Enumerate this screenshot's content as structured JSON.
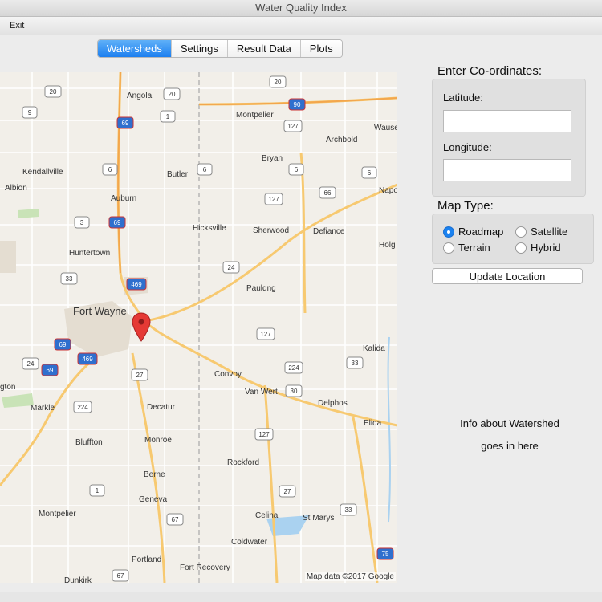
{
  "window": {
    "title": "Water Quality Index"
  },
  "menu": {
    "exit": "Exit"
  },
  "tabs": [
    "Watersheds",
    "Settings",
    "Result Data",
    "Plots"
  ],
  "active_tab": "Watersheds",
  "panel": {
    "coords_heading": "Enter Co-ordinates:",
    "latitude_label": "Latitude:",
    "latitude_value": "",
    "longitude_label": "Longitude:",
    "longitude_value": "",
    "maptype_heading": "Map Type:",
    "map_types": [
      "Roadmap",
      "Satellite",
      "Terrain",
      "Hybrid"
    ],
    "selected_map_type": "Roadmap",
    "update_button": "Update Location",
    "info_line1": "Info about Watershed",
    "info_line2": "goes in here"
  },
  "map": {
    "credit": "Map data ©2017 Google",
    "places": [
      "Angola",
      "Montpelier",
      "Archbold",
      "Wause",
      "Kendallville",
      "Bryan",
      "Albion",
      "Butler",
      "Napo",
      "Auburn",
      "Hicksville",
      "Sherwood",
      "Defiance",
      "Holg",
      "Huntertown",
      "Pauldng",
      "Fort Wayne",
      "Kalida",
      "Convoy",
      "gton",
      "Van Wert",
      "Delphos",
      "Markle",
      "Decatur",
      "Elida",
      "Bluffton",
      "Monroe",
      "Rockford",
      "Berne",
      "Geneva",
      "Montpelier",
      "Celina",
      "St Marys",
      "Coldwater",
      "Portland",
      "Fort Recovery",
      "Dunkirk"
    ],
    "shields": [
      "20",
      "20",
      "20",
      "1",
      "9",
      "90",
      "127",
      "69",
      "6",
      "6",
      "6",
      "6",
      "66",
      "127",
      "3",
      "69",
      "24",
      "469",
      "33",
      "127",
      "69",
      "24",
      "469",
      "224",
      "27",
      "30",
      "224",
      "127",
      "1",
      "27",
      "33",
      "67",
      "75",
      "67"
    ]
  },
  "icons": {
    "marker": "map-marker-icon"
  },
  "colors": {
    "accent": "#1c7ff0",
    "marker": "#e53935"
  }
}
